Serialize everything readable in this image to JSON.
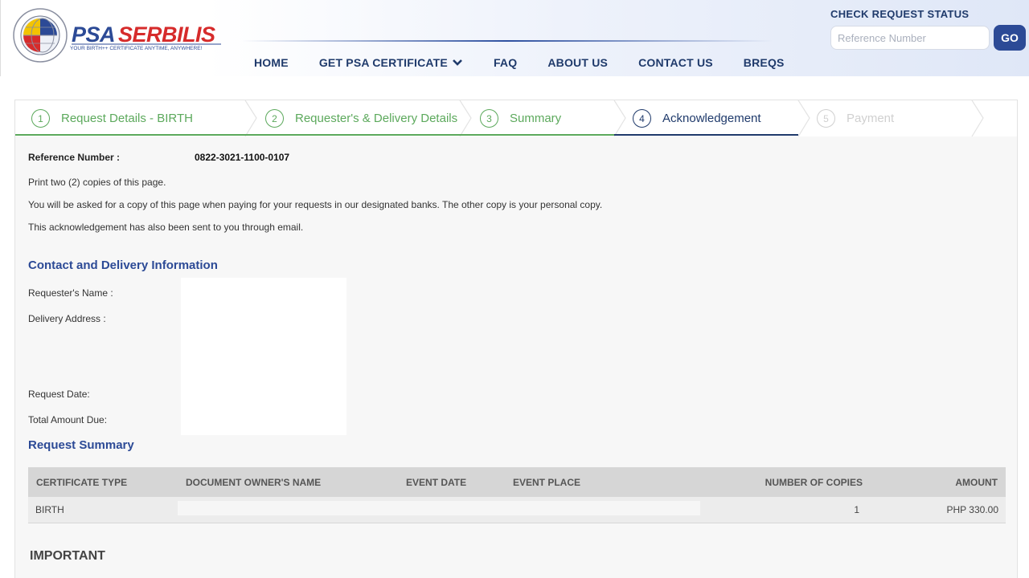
{
  "brand": {
    "name": "PSA SERBILIS",
    "name_part1": "PSA",
    "name_part2": "SERBILIS",
    "tagline": "YOUR BIRTH++ CERTIFICATE ANYTIME, ANYWHERE!",
    "seal_text": "PHILIPPINE STATISTICS AUTHORITY",
    "seal_motto": "Solid • Responsive • World-class"
  },
  "nav": {
    "items": [
      {
        "label": "HOME"
      },
      {
        "label": "GET PSA CERTIFICATE",
        "icon": "chevron-down-icon"
      },
      {
        "label": "FAQ"
      },
      {
        "label": "ABOUT US"
      },
      {
        "label": "CONTACT US"
      },
      {
        "label": "BREQS"
      }
    ]
  },
  "check_status": {
    "title": "CHECK REQUEST STATUS",
    "placeholder": "Reference Number",
    "button": "GO"
  },
  "steps": [
    {
      "num": "1",
      "label": "Request Details - BIRTH",
      "state": "done"
    },
    {
      "num": "2",
      "label": "Requester's & Delivery Details",
      "state": "done"
    },
    {
      "num": "3",
      "label": "Summary",
      "state": "done"
    },
    {
      "num": "4",
      "label": "Acknowledgement",
      "state": "active"
    },
    {
      "num": "5",
      "label": "Payment",
      "state": "todo"
    }
  ],
  "reference": {
    "label": "Reference Number :",
    "value": "0822-3021-1100-0107"
  },
  "instructions": [
    "Print two (2) copies of this page.",
    "You will be asked for a copy of this page when paying for your requests in our designated banks. The other copy is your personal copy.",
    "This acknowledgement has also been sent to you through email."
  ],
  "contact": {
    "title": "Contact and Delivery Information",
    "requester_name_label": "Requester's Name :",
    "delivery_address_label": "Delivery Address :",
    "request_date_label": "Request Date:",
    "total_amount_label": "Total Amount Due:"
  },
  "summary": {
    "title": "Request Summary",
    "columns": [
      "CERTIFICATE TYPE",
      "DOCUMENT OWNER'S NAME",
      "EVENT DATE",
      "EVENT PLACE",
      "NUMBER OF COPIES",
      "AMOUNT"
    ],
    "rows": [
      {
        "type": "BIRTH",
        "owner": "",
        "date": "",
        "place": "",
        "copies": "1",
        "amount": "PHP 330.00"
      }
    ]
  },
  "important": {
    "title": "IMPORTANT"
  },
  "colors": {
    "brand_blue": "#2c4a96",
    "brand_red": "#d62b2b",
    "done_green": "#5ca95c",
    "active_navy": "#1f3a6b"
  }
}
